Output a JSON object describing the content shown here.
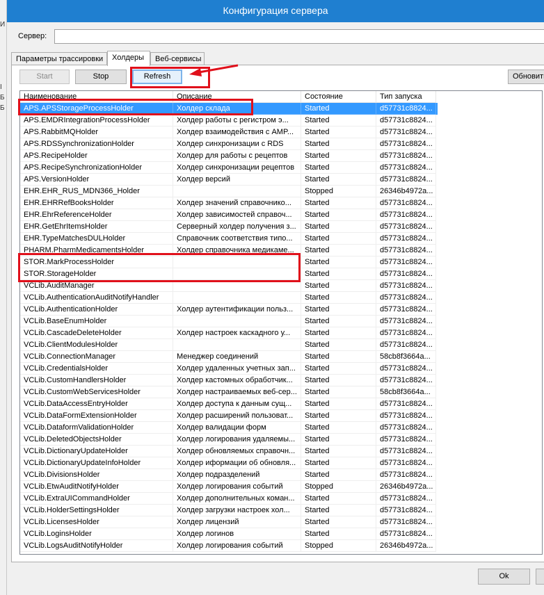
{
  "left_strip_chars": [
    "И",
    "І",
    "Б",
    "Б"
  ],
  "window": {
    "title": "Конфигурация сервера"
  },
  "server": {
    "label": "Сервер:",
    "value": ""
  },
  "tabs": [
    {
      "label": "Параметры трассировки",
      "active": false
    },
    {
      "label": "Холдеры",
      "active": true
    },
    {
      "label": "Веб-сервисы",
      "active": false
    }
  ],
  "toolbar": {
    "start_label": "Start",
    "stop_label": "Stop",
    "refresh_label": "Refresh",
    "update_label": "Обновить"
  },
  "table": {
    "columns": [
      "Наименование",
      "Описание",
      "Состояние",
      "Тип запуска"
    ],
    "rows": [
      {
        "name": "APS.APSStorageProcessHolder",
        "desc": "Холдер склада",
        "state": "Started",
        "type": "d57731c8824...",
        "selected": true
      },
      {
        "name": "APS.EMDRIntegrationProcessHolder",
        "desc": "Холдер работы с регистром э...",
        "state": "Started",
        "type": "d57731c8824..."
      },
      {
        "name": "APS.RabbitMQHolder",
        "desc": "Холдер взаимодействия с AMP...",
        "state": "Started",
        "type": "d57731c8824..."
      },
      {
        "name": "APS.RDSSynchronizationHolder",
        "desc": "Холдер синхронизации с RDS",
        "state": "Started",
        "type": "d57731c8824..."
      },
      {
        "name": "APS.RecipeHolder",
        "desc": "Холдер для работы с рецептов",
        "state": "Started",
        "type": "d57731c8824..."
      },
      {
        "name": "APS.RecipeSynchronizationHolder",
        "desc": "Холдер синхронизации рецептов",
        "state": "Started",
        "type": "d57731c8824..."
      },
      {
        "name": "APS.VersionHolder",
        "desc": "Холдер версий",
        "state": "Started",
        "type": "d57731c8824..."
      },
      {
        "name": "EHR.EHR_RUS_MDN366_Holder",
        "desc": "",
        "state": "Stopped",
        "type": "26346b4972a..."
      },
      {
        "name": "EHR.EHRRefBooksHolder",
        "desc": "Холдер значений справочнико...",
        "state": "Started",
        "type": "d57731c8824..."
      },
      {
        "name": "EHR.EhrReferenceHolder",
        "desc": "Холдер зависимостей справоч...",
        "state": "Started",
        "type": "d57731c8824..."
      },
      {
        "name": "EHR.GetEhrItemsHolder",
        "desc": "Серверный холдер получения з...",
        "state": "Started",
        "type": "d57731c8824..."
      },
      {
        "name": "EHR.TypeMatchesDULHolder",
        "desc": "Справочник соответствия типо...",
        "state": "Started",
        "type": "d57731c8824..."
      },
      {
        "name": "PHARM.PharmMedicamentsHolder",
        "desc": "Холдер справочника медикаме...",
        "state": "Started",
        "type": "d57731c8824..."
      },
      {
        "name": "STOR.MarkProcessHolder",
        "desc": "",
        "state": "Started",
        "type": "d57731c8824..."
      },
      {
        "name": "STOR.StorageHolder",
        "desc": "",
        "state": "Started",
        "type": "d57731c8824..."
      },
      {
        "name": "VCLib.AuditManager",
        "desc": "",
        "state": "Started",
        "type": "d57731c8824..."
      },
      {
        "name": "VCLib.AuthenticationAuditNotifyHandler",
        "desc": "",
        "state": "Started",
        "type": "d57731c8824..."
      },
      {
        "name": "VCLib.AuthenticationHolder",
        "desc": "Холдер аутентификации польз...",
        "state": "Started",
        "type": "d57731c8824..."
      },
      {
        "name": "VCLib.BaseEnumHolder",
        "desc": "",
        "state": "Started",
        "type": "d57731c8824..."
      },
      {
        "name": "VCLib.CascadeDeleteHolder",
        "desc": "Холдер настроек каскадного у...",
        "state": "Started",
        "type": "d57731c8824..."
      },
      {
        "name": "VCLib.ClientModulesHolder",
        "desc": "",
        "state": "Started",
        "type": "d57731c8824..."
      },
      {
        "name": "VCLib.ConnectionManager",
        "desc": "Менеджер соединений",
        "state": "Started",
        "type": "58cb8f3664a..."
      },
      {
        "name": "VCLib.CredentialsHolder",
        "desc": "Холдер удаленных учетных зап...",
        "state": "Started",
        "type": "d57731c8824..."
      },
      {
        "name": "VCLib.CustomHandlersHolder",
        "desc": "Холдер кастомных обработчик...",
        "state": "Started",
        "type": "d57731c8824..."
      },
      {
        "name": "VCLib.CustomWebServicesHolder",
        "desc": "Холдер настраиваемых веб-сер...",
        "state": "Started",
        "type": "58cb8f3664a..."
      },
      {
        "name": "VCLib.DataAccessEntryHolder",
        "desc": "Холдер доступа к данным сущ...",
        "state": "Started",
        "type": "d57731c8824..."
      },
      {
        "name": "VCLib.DataFormExtensionHolder",
        "desc": "Холдер расширений пользоват...",
        "state": "Started",
        "type": "d57731c8824..."
      },
      {
        "name": "VCLib.DataformValidationHolder",
        "desc": "Холдер валидации форм",
        "state": "Started",
        "type": "d57731c8824..."
      },
      {
        "name": "VCLib.DeletedObjectsHolder",
        "desc": "Холдер логирования удаляемы...",
        "state": "Started",
        "type": "d57731c8824..."
      },
      {
        "name": "VCLib.DictionaryUpdateHolder",
        "desc": "Холдер обновляемых справочн...",
        "state": "Started",
        "type": "d57731c8824..."
      },
      {
        "name": "VCLib.DictionaryUpdateInfoHolder",
        "desc": "Холдер иформации об обновля...",
        "state": "Started",
        "type": "d57731c8824..."
      },
      {
        "name": "VCLib.DivisionsHolder",
        "desc": "Холдер подразделений",
        "state": "Started",
        "type": "d57731c8824..."
      },
      {
        "name": "VCLib.EtwAuditNotifyHolder",
        "desc": "Холдер логирования событий",
        "state": "Stopped",
        "type": "26346b4972a..."
      },
      {
        "name": "VCLib.ExtraUICommandHolder",
        "desc": "Холдер дополнительных коман...",
        "state": "Started",
        "type": "d57731c8824..."
      },
      {
        "name": "VCLib.HolderSettingsHolder",
        "desc": "Холдер загрузки настроек хол...",
        "state": "Started",
        "type": "d57731c8824..."
      },
      {
        "name": "VCLib.LicensesHolder",
        "desc": "Холдер лицензий",
        "state": "Started",
        "type": "d57731c8824..."
      },
      {
        "name": "VCLib.LoginsHolder",
        "desc": "Холдер логинов",
        "state": "Started",
        "type": "d57731c8824..."
      },
      {
        "name": "VCLib.LogsAuditNotifyHolder",
        "desc": "Холдер логирования событий",
        "state": "Stopped",
        "type": "26346b4972a..."
      }
    ]
  },
  "footer": {
    "ok_label": "Ok"
  },
  "colors": {
    "title_bar": "#1f7fd0",
    "selection": "#3399ff",
    "annotation": "#e0101b"
  }
}
